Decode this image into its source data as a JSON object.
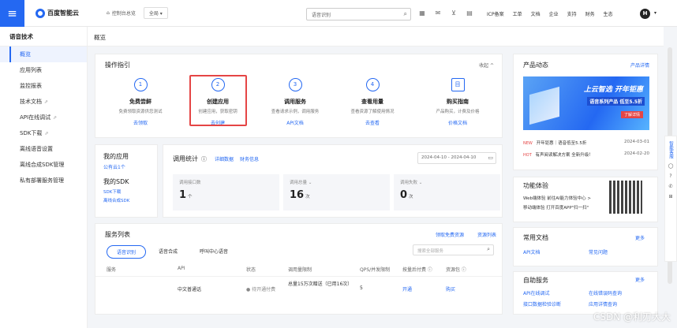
{
  "topbar": {
    "brand": "百度智能云",
    "home": "控制台总览",
    "region": "全局 ▾",
    "search_value": "语音识别",
    "links": [
      "ICP备案",
      "工单",
      "文档",
      "企业",
      "支持",
      "财务",
      "生态"
    ],
    "avatar": "H"
  },
  "sidebar": {
    "title": "语音技术",
    "items": [
      {
        "label": "概览",
        "ext": ""
      },
      {
        "label": "应用列表",
        "ext": ""
      },
      {
        "label": "监控报表",
        "ext": ""
      },
      {
        "label": "技术文档",
        "ext": "⇗"
      },
      {
        "label": "API在线调试",
        "ext": "⇗"
      },
      {
        "label": "SDK下载",
        "ext": "⇗"
      },
      {
        "label": "离线语音设置",
        "ext": ""
      },
      {
        "label": "离线合成SDK管理",
        "ext": ""
      },
      {
        "label": "私有部署服务管理",
        "ext": ""
      }
    ]
  },
  "breadcrumb": "概览",
  "guide": {
    "title": "操作指引",
    "collapse": "收起 ^",
    "steps": [
      {
        "num": "1",
        "title": "免费尝鲜",
        "desc": "免费领取资源供您测试",
        "link": "去领取"
      },
      {
        "num": "2",
        "title": "创建应用",
        "desc": "创建应用，获取密钥",
        "link": "去创建"
      },
      {
        "num": "3",
        "title": "调用服务",
        "desc": "查看请求示例，调用服务",
        "link": "API文档"
      },
      {
        "num": "4",
        "title": "查看用量",
        "desc": "查看资源了解使用情况",
        "link": "去查看"
      },
      {
        "num": "目",
        "title": "购买指南",
        "desc": "产品购买，计费及价格",
        "link": "价格文档"
      }
    ]
  },
  "apps": {
    "my_app": "我的应用",
    "app_count": "公有云1个",
    "my_sdk": "我的SDK",
    "sdk_download": "SDK下载",
    "sdk_offline": "离线合成SDK"
  },
  "stats": {
    "title": "调用统计",
    "detail": "详细数据",
    "notes": "财务信息",
    "date_range": "2024-04-10 - 2024-04-10",
    "boxes": [
      {
        "label": "调用接口数",
        "value": "1",
        "unit": "个"
      },
      {
        "label": "调用总量 ⌄",
        "value": "16",
        "unit": "次"
      },
      {
        "label": "调用失败 ⌄",
        "value": "0",
        "unit": "次"
      }
    ]
  },
  "services": {
    "title": "服务列表",
    "link1": "领取免费资源",
    "link2": "资源列表",
    "tabs": [
      "语音识别",
      "语音合成",
      "呼叫中心语音"
    ],
    "search_placeholder": "搜索全部服务",
    "columns": [
      "服务",
      "API",
      "状态",
      "调用量限制",
      "QPS/并发限制",
      "按量后付费 ⓘ",
      "资源包 ⓘ"
    ],
    "rows": [
      {
        "api": "中文普通话",
        "status": "● 待开通付费",
        "limit": "总量15万次赠送（已用16次）",
        "qps": "5",
        "postpay": "开通",
        "pkg": "购买"
      }
    ]
  },
  "product": {
    "title": "产品动态",
    "more": "产品详情",
    "banner_line1": "上云智选 开年钜惠",
    "banner_line2": "语音系列产品 低至5.5折",
    "banner_btn": "了解详情",
    "news": [
      {
        "tag": "NEW",
        "text": "开年钜惠｜语音低至5.5折",
        "date": "2024-03-01"
      },
      {
        "tag": "HOT",
        "text": "有声阅读解决方案 全新升级！",
        "date": "2024-02-20"
      }
    ]
  },
  "func": {
    "title": "功能体验",
    "line1": "Web端体验 前往AI能力体验中心 >",
    "line2": "移动端体验 打开百度APP\"扫一扫\""
  },
  "docs": {
    "title": "常用文档",
    "more": "更多",
    "items": [
      "API文档",
      "常见问题"
    ]
  },
  "self": {
    "title": "自助服务",
    "more": "更多",
    "items": [
      "API在线调试",
      "在线错误码查询",
      "接口数据检验诊断",
      "应用详情查询"
    ]
  },
  "rightbar": [
    "智能客服",
    "◯",
    "?",
    "✆",
    "⊞"
  ],
  "watermark": "CSDN @利刃大大",
  "colors": {
    "accent": "#2468f2",
    "highlight": "#e54545"
  }
}
